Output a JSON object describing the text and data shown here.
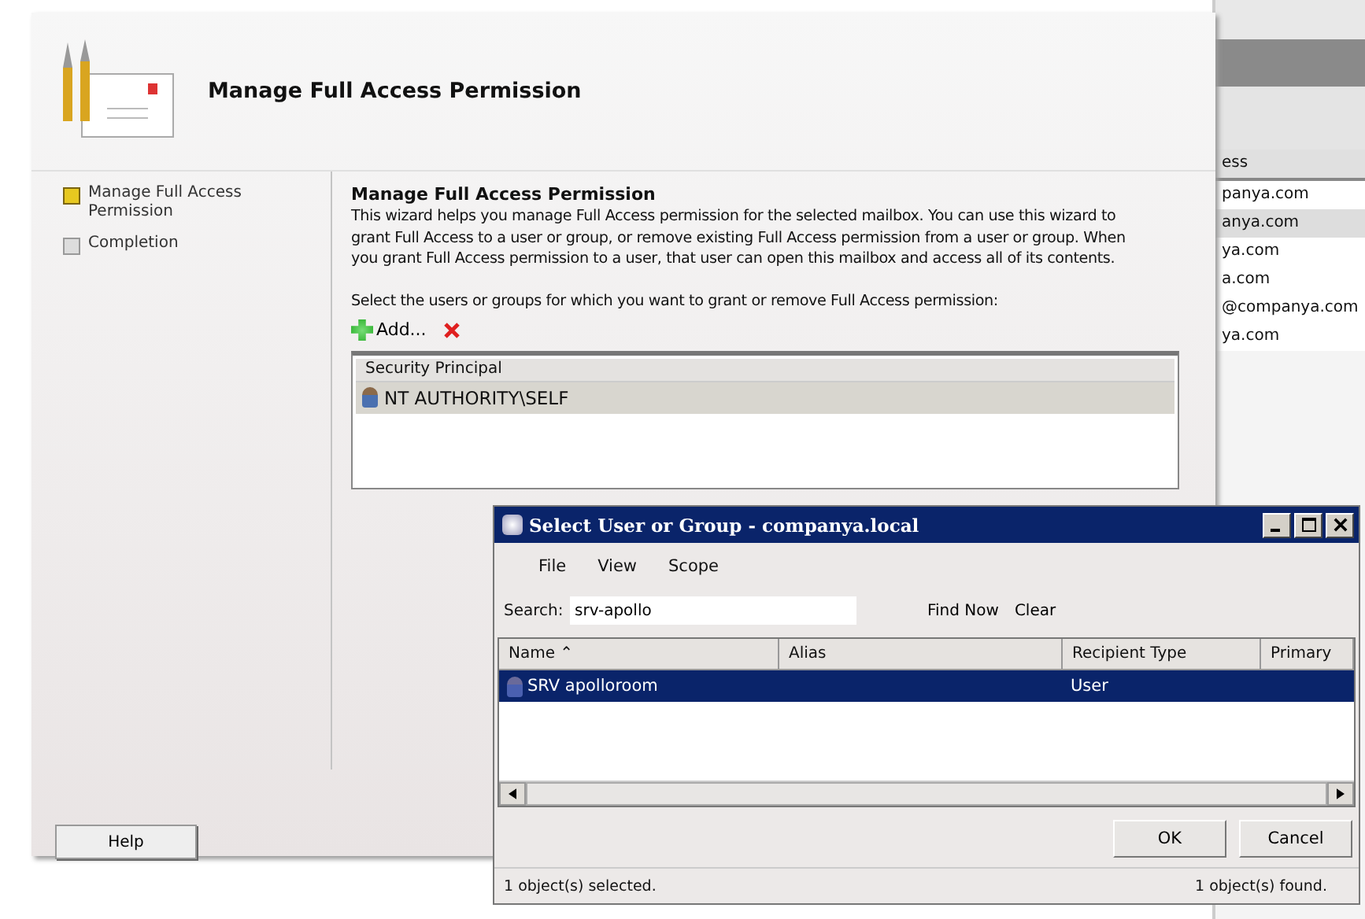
{
  "back_window": {
    "column_header": "ess",
    "rows": [
      {
        "text": "panya.com",
        "selected": false
      },
      {
        "text": "anya.com",
        "selected": true
      },
      {
        "text": "ya.com",
        "selected": false
      },
      {
        "text": "a.com",
        "selected": false
      },
      {
        "text": "@companya.com",
        "selected": false
      },
      {
        "text": "ya.com",
        "selected": false
      }
    ]
  },
  "wizard": {
    "title": "Manage Full Access Permission",
    "steps": [
      {
        "label": "Manage Full Access Permission",
        "selected": true
      },
      {
        "label": "Completion",
        "selected": false
      }
    ],
    "heading": "Manage Full Access Permission",
    "description": "This wizard helps you manage Full Access permission for the selected mailbox. You can use this wizard to grant Full Access to a user or group, or remove existing Full Access permission from a user or group. When you grant Full Access permission to a user, that user can open this mailbox and access all of its contents.",
    "prompt": "Select the users or groups for which you want to grant or remove Full Access permission:",
    "add_label": "Add...",
    "list_column": "Security Principal",
    "principals": [
      {
        "name": "NT AUTHORITY\\SELF",
        "selected": true
      }
    ],
    "help_button": "Help"
  },
  "dialog": {
    "title": "Select User or Group - companya.local",
    "menu": [
      "File",
      "View",
      "Scope"
    ],
    "search_label": "Search:",
    "search_value": "srv-apollo",
    "find_now": "Find Now",
    "clear": "Clear",
    "columns": [
      "Name  ⌃",
      "Alias",
      "Recipient Type",
      "Primary"
    ],
    "rows": [
      {
        "name": "SRV apolloroom",
        "alias": "",
        "recipient_type": "User",
        "selected": true
      }
    ],
    "ok": "OK",
    "cancel": "Cancel",
    "status_left": "1 object(s) selected.",
    "status_right": "1 object(s) found."
  }
}
